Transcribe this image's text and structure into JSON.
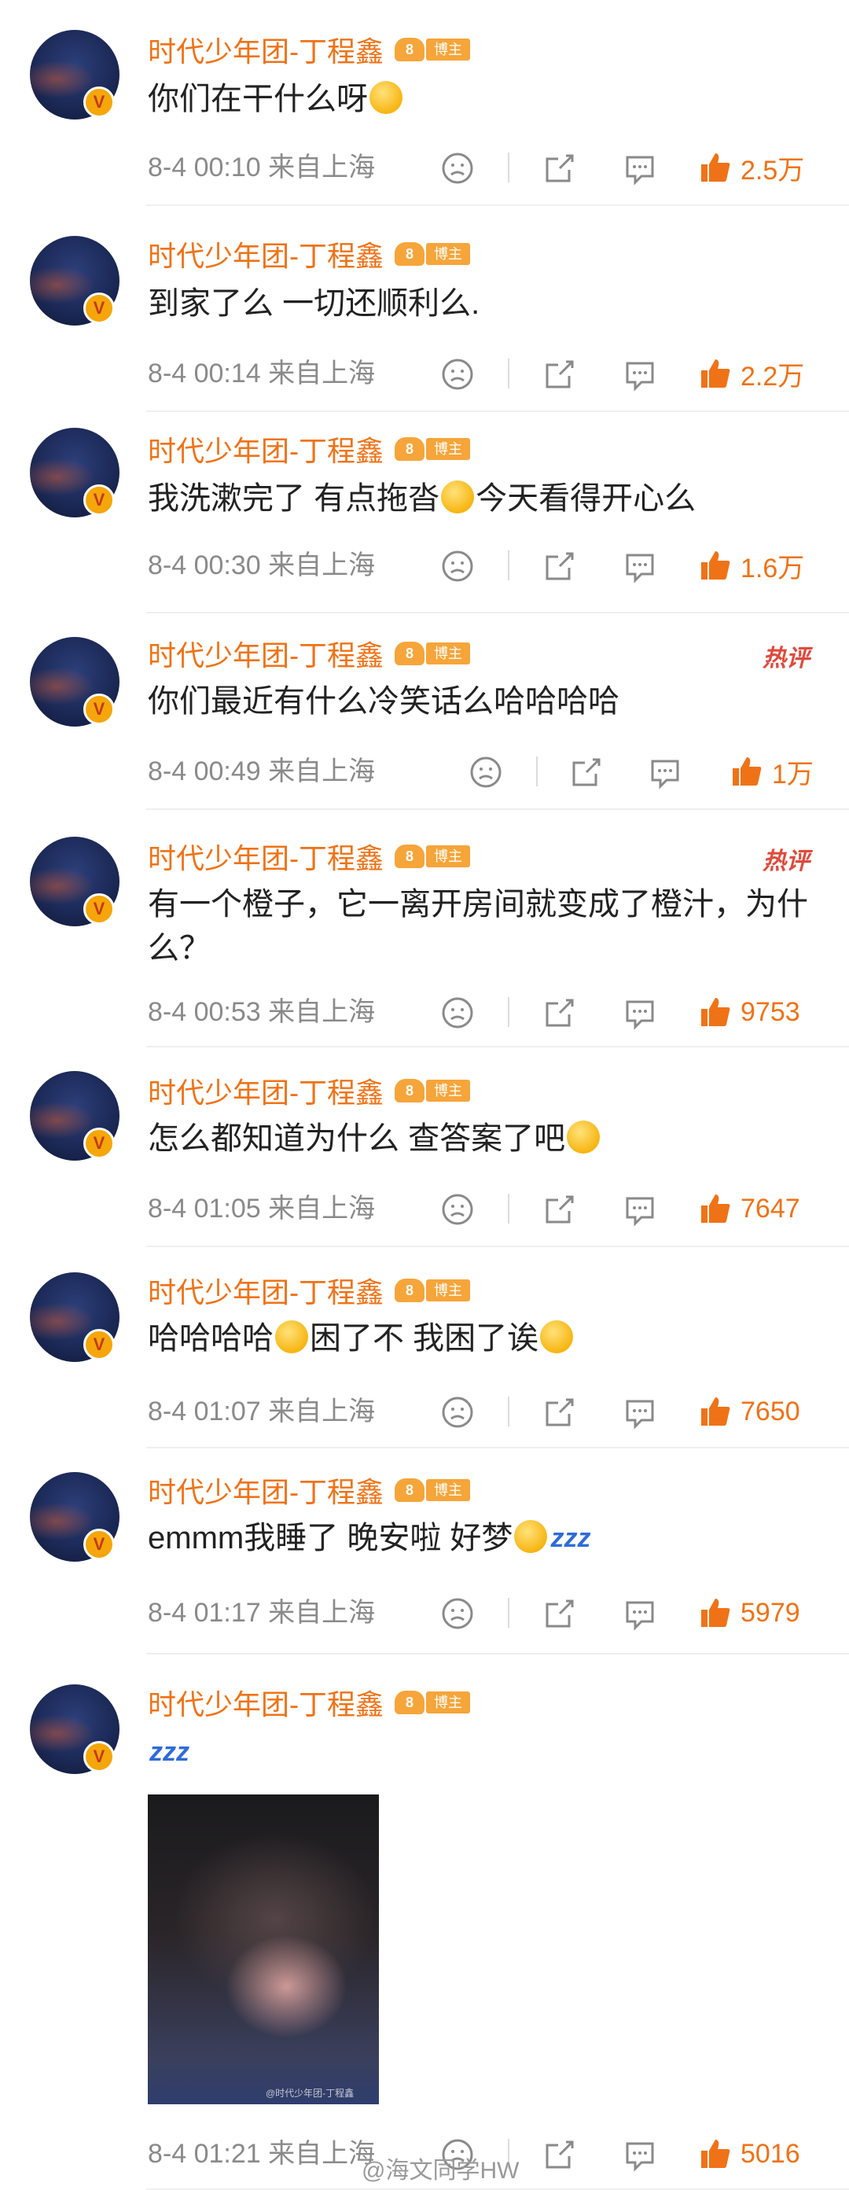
{
  "comments": [
    {
      "username": "时代少年团-丁程鑫",
      "level": "8",
      "role": "博主",
      "text": "你们在干什么呀",
      "emoji": [
        "laugh-emoji"
      ],
      "time": "8-4 00:10 来自上海",
      "likes": "2.5万"
    },
    {
      "username": "时代少年团-丁程鑫",
      "level": "8",
      "role": "博主",
      "text": "到家了么 一切还顺利么.",
      "time": "8-4 00:14 来自上海",
      "likes": "2.2万"
    },
    {
      "username": "时代少年团-丁程鑫",
      "level": "8",
      "role": "博主",
      "text_a": "我洗漱完了 有点拖沓",
      "text_b": "今天看得开心么",
      "time": "8-4 00:30 来自上海",
      "likes": "1.6万"
    },
    {
      "username": "时代少年团-丁程鑫",
      "level": "8",
      "role": "博主",
      "hot": "热评",
      "text": "你们最近有什么冷笑话么哈哈哈哈",
      "time": "8-4 00:49 来自上海",
      "likes": "1万"
    },
    {
      "username": "时代少年团-丁程鑫",
      "level": "8",
      "role": "博主",
      "hot": "热评",
      "text": "有一个橙子，它一离开房间就变成了橙汁，为什么？",
      "time": "8-4 00:53 来自上海",
      "likes": "9753"
    },
    {
      "username": "时代少年团-丁程鑫",
      "level": "8",
      "role": "博主",
      "text": "怎么都知道为什么 查答案了吧",
      "time": "8-4 01:05 来自上海",
      "likes": "7647"
    },
    {
      "username": "时代少年团-丁程鑫",
      "level": "8",
      "role": "博主",
      "text_a": "哈哈哈哈",
      "text_b": "困了不 我困了诶",
      "time": "8-4 01:07 来自上海",
      "likes": "7650"
    },
    {
      "username": "时代少年团-丁程鑫",
      "level": "8",
      "role": "博主",
      "text": "emmm我睡了 晚安啦 好梦",
      "zzz": "zzz",
      "time": "8-4 01:17 来自上海",
      "likes": "5979"
    },
    {
      "username": "时代少年团-丁程鑫",
      "level": "8",
      "role": "博主",
      "zzz": "zzz",
      "photo_watermark": "@时代少年团-丁程鑫",
      "time": "8-4 01:21 来自上海",
      "likes": "5016"
    }
  ],
  "watermark": "@海文同学HW",
  "colors": {
    "accent": "#f07216",
    "hot": "#e04a3c",
    "meta": "#8a8a8a"
  }
}
